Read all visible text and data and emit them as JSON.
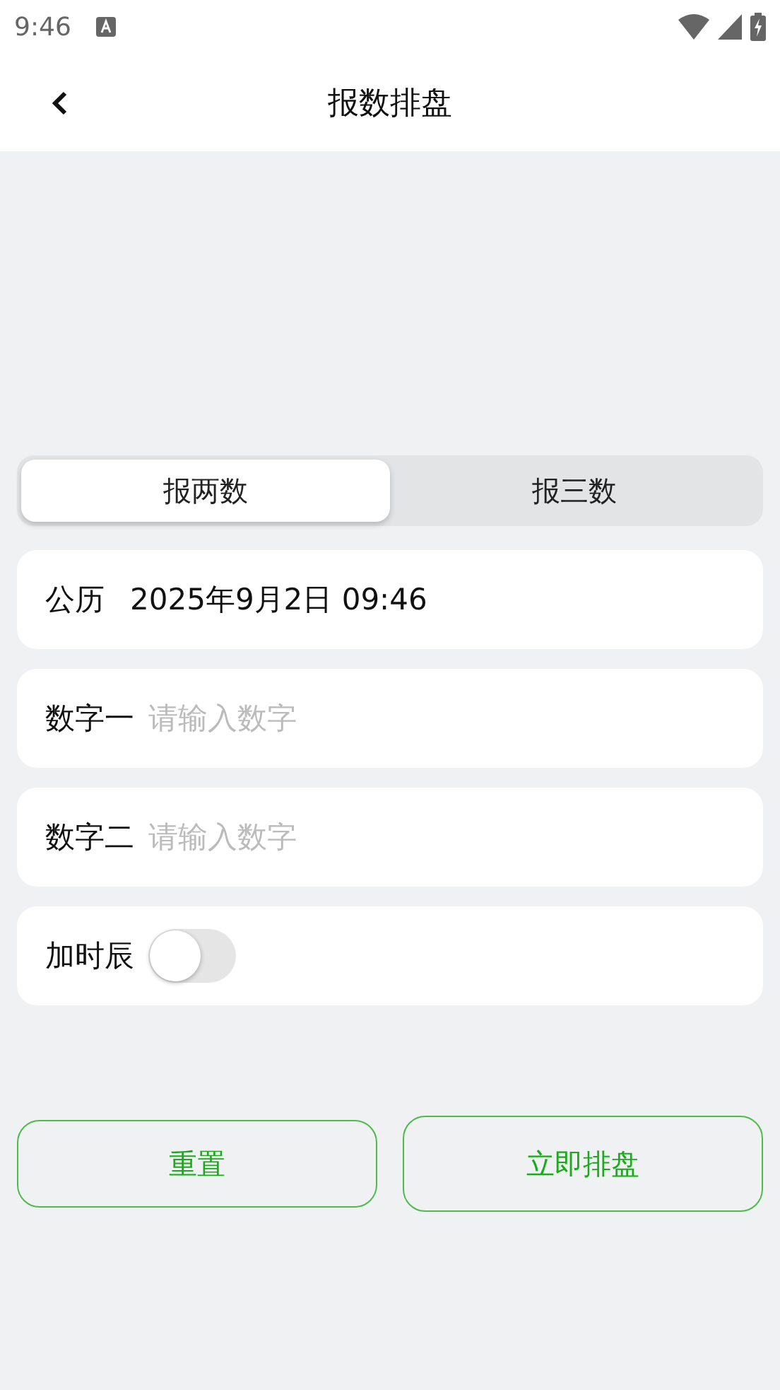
{
  "status_bar": {
    "time": "9:46"
  },
  "header": {
    "title": "报数排盘"
  },
  "tabs": [
    {
      "label": "报两数",
      "selected": true
    },
    {
      "label": "报三数",
      "selected": false
    }
  ],
  "rows": [
    {
      "kind": "date",
      "label": "公历",
      "value": "2025年9月2日 09:46"
    },
    {
      "kind": "input",
      "label": "数字一",
      "placeholder": "请输入数字"
    },
    {
      "kind": "input",
      "label": "数字二",
      "placeholder": "请输入数字"
    },
    {
      "kind": "toggle",
      "label": "加时辰",
      "on": false
    }
  ],
  "buttons": [
    {
      "label": "重置"
    },
    {
      "label": "立即排盘"
    }
  ]
}
